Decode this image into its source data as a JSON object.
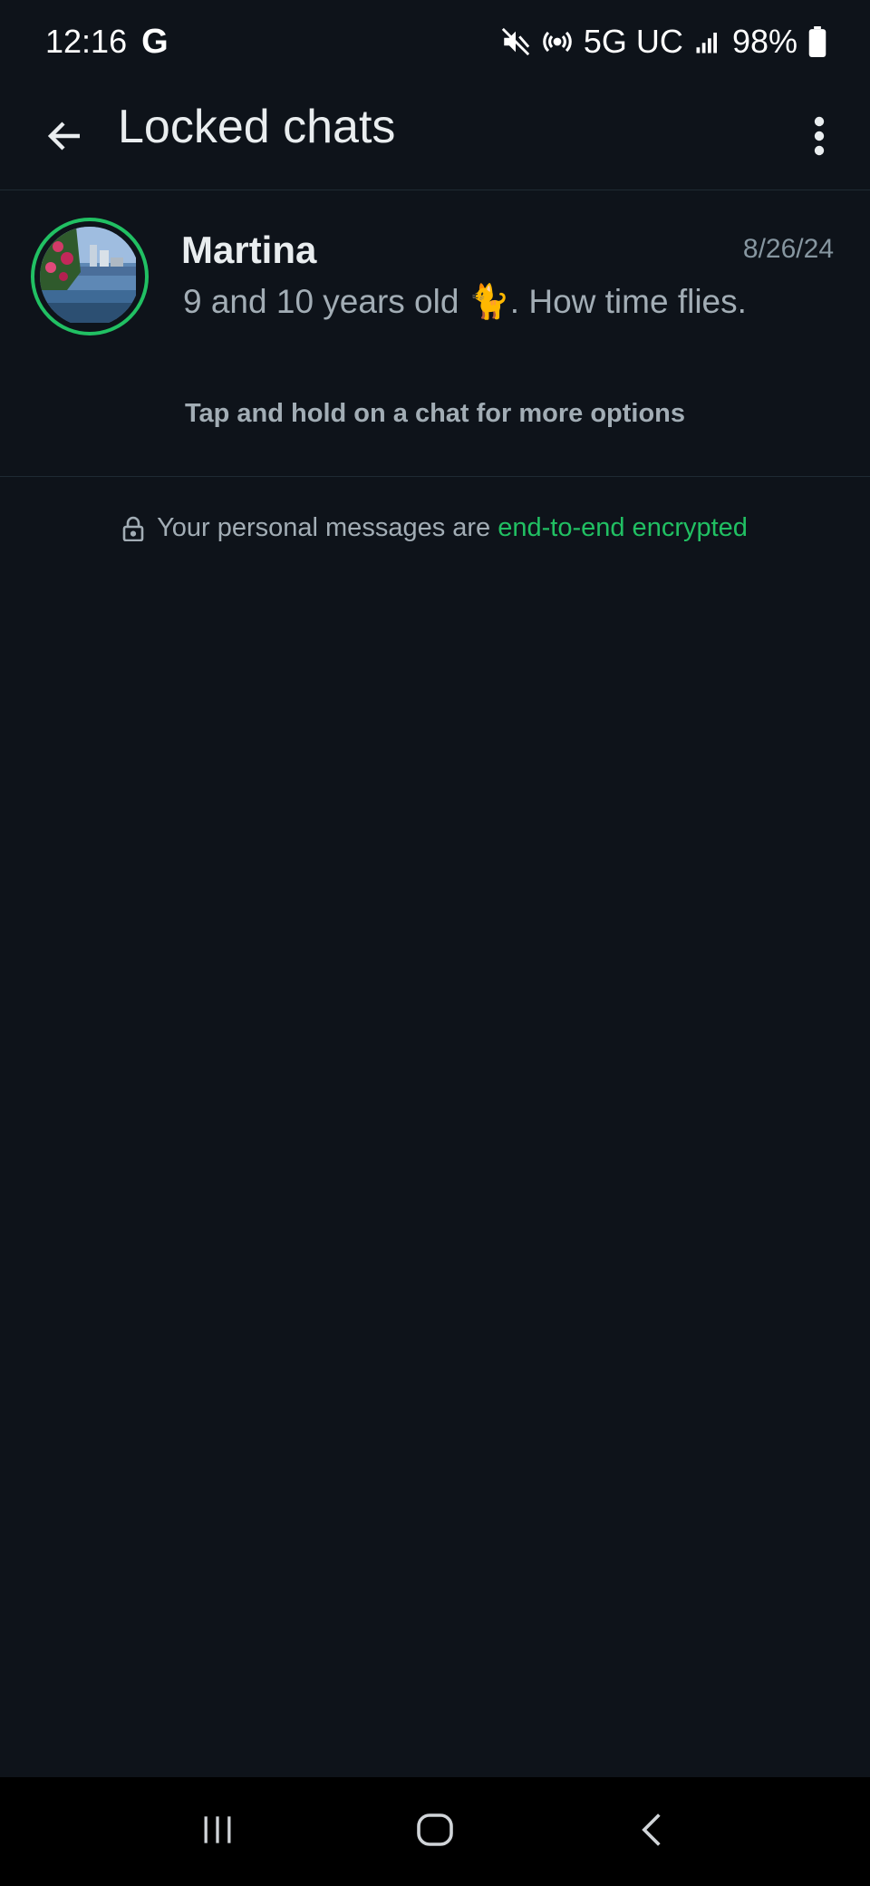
{
  "status_bar": {
    "time": "12:16",
    "google_icon": "G",
    "network": "5G UC",
    "battery": "98%",
    "icons": [
      "mute-icon",
      "hotspot-icon",
      "signal-icon",
      "battery-icon"
    ]
  },
  "app_bar": {
    "title": "Locked chats",
    "back_icon": "arrow-left-icon",
    "menu_icon": "more-vertical-icon"
  },
  "chats": [
    {
      "name": "Martina",
      "date": "8/26/24",
      "preview_prefix": "9 and 10 years old ",
      "preview_emoji": "🐈",
      "preview_suffix": ". How time flies."
    }
  ],
  "hint": "Tap and hold on a chat for more options",
  "encryption": {
    "text": "Your personal messages are ",
    "link": "end-to-end encrypted",
    "icon": "lock-icon"
  },
  "nav_bar": {
    "icons": [
      "recent-apps-icon",
      "home-icon",
      "back-icon"
    ]
  },
  "colors": {
    "background": "#0e131a",
    "accent": "#21c063",
    "text_primary": "#e9edef",
    "text_secondary": "#a2adb5"
  }
}
